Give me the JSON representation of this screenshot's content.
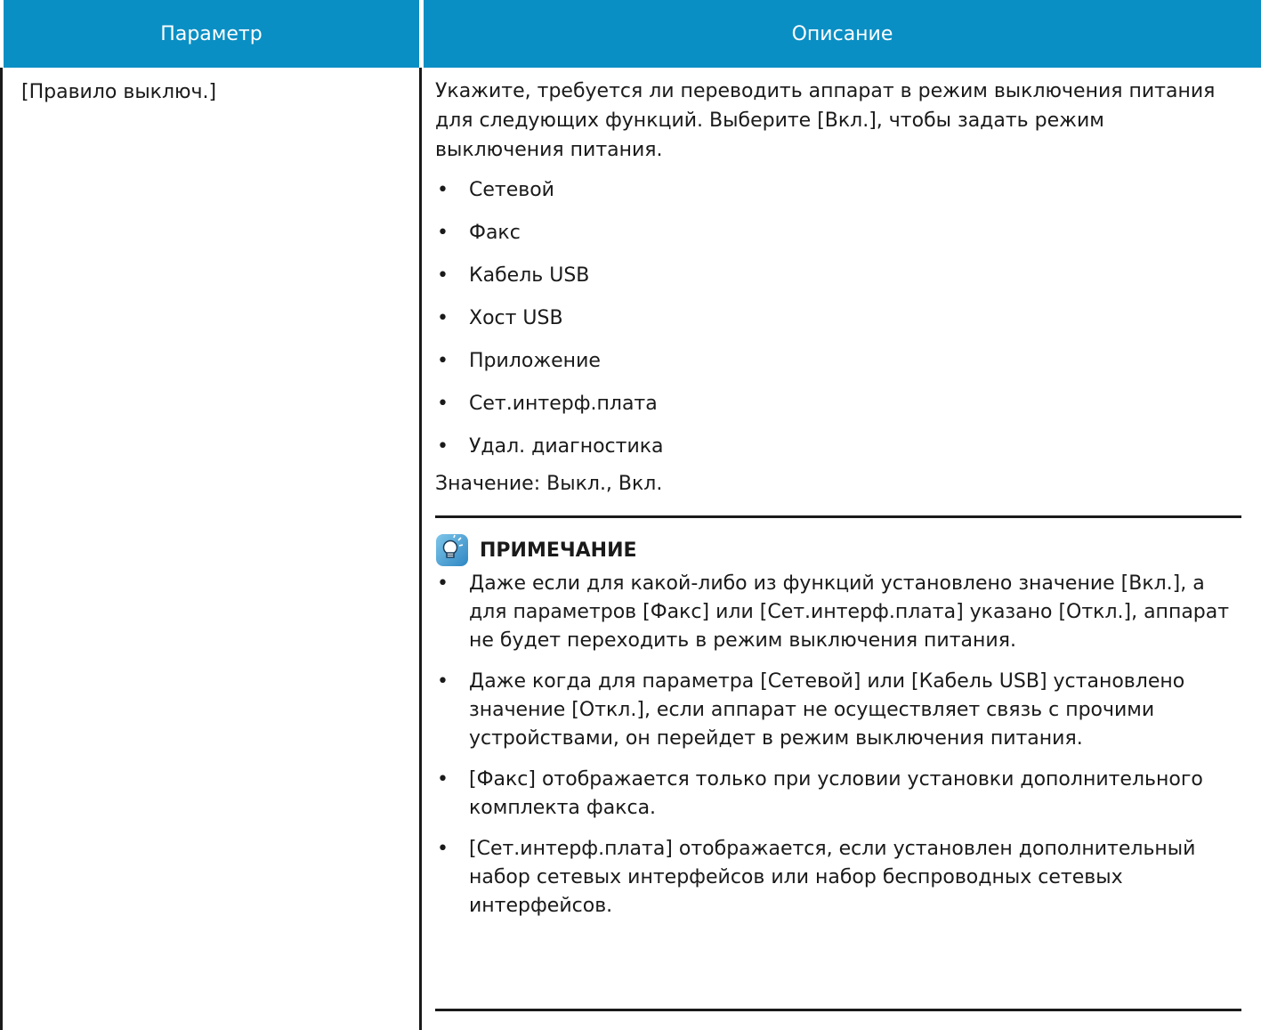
{
  "colors": {
    "header_bg": "#0a8fc4",
    "rule": "#1a1a1a",
    "icon": "note-lightbulb-icon"
  },
  "table": {
    "headers": {
      "param": "Параметр",
      "desc": "Описание"
    },
    "row": {
      "param": "[Правило выключ.]",
      "intro": "Укажите, требуется ли переводить аппарат в режим выключения питания для следующих функций. Выберите [Вкл.], чтобы задать режим выключения питания.",
      "features": [
        "Сетевой",
        "Факс",
        "Кабель USB",
        "Хост USB",
        "Приложение",
        "Сет.интерф.плата",
        "Удал. диагностика"
      ],
      "value": "Значение: Выкл., Вкл.",
      "note": {
        "title": "ПРИМЕЧАНИЕ",
        "items": [
          "Даже если для какой-либо из функций установлено значение [Вкл.], а для параметров [Факс] или [Сет.интерф.плата] указано [Откл.], аппарат не будет переходить в режим выключения питания.",
          "Даже когда для параметра [Сетевой] или [Кабель USB] установлено значение [Откл.], если аппарат не осуществляет связь с прочими устройствами, он перейдет в режим выключения питания.",
          "[Факс] отображается только при условии установки дополнительного комплекта факса.",
          "[Сет.интерф.плата] отображается, если установлен дополнительный набор сетевых интерфейсов или набор беспроводных сетевых интерфейсов."
        ]
      }
    }
  },
  "bullet": "•"
}
